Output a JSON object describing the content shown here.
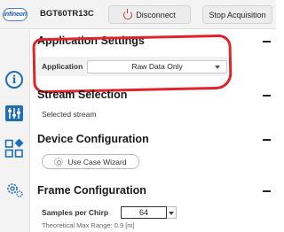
{
  "header": {
    "logo_text": "infineon",
    "device_name": "BGT60TR13C",
    "disconnect_label": "Disconnect",
    "stop_label": "Stop Acquisition"
  },
  "sidebar": {
    "items": [
      {
        "icon": "info-icon"
      },
      {
        "icon": "sliders-icon"
      },
      {
        "icon": "shapes-icon"
      },
      {
        "icon": "gear-icon"
      }
    ]
  },
  "sections": {
    "app_settings": {
      "title": "Application Settings",
      "field_label": "Application",
      "selected_value": "Raw Data Only"
    },
    "stream_selection": {
      "title": "Stream Selection",
      "selected_text": "Selected stream"
    },
    "device_config": {
      "title": "Device Configuration",
      "wizard_label": "Use Case Wizard"
    },
    "frame_config": {
      "title": "Frame Configuration",
      "samples_label": "Samples per Chirp",
      "samples_value": "64",
      "max_range_text": "Theoretical Max Range: 0.9 [m]"
    }
  },
  "colors": {
    "accent_blue": "#1f6fb2",
    "annotation_red": "#e0242b",
    "power_red": "#c23a3a"
  }
}
